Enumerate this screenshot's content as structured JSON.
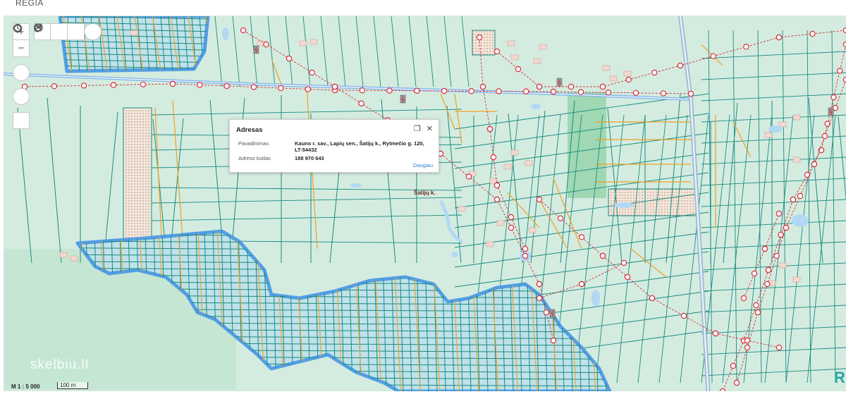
{
  "app": {
    "brand": "REGIA"
  },
  "toolbar": {
    "zoom_in": "+",
    "zoom_out": "−",
    "icons": [
      "print-icon",
      "mouse-icon",
      "share-icon",
      "locate-icon",
      "history-icon",
      "target-icon",
      "polygon-icon"
    ]
  },
  "popup": {
    "title": "Adresas",
    "rows": [
      {
        "label": "Pavadinimas",
        "value": "Kauno r. sav., Lapių sen., Šatijų k., Rytmečio g. 120, LT-54432"
      },
      {
        "label": "Adreso kodas",
        "value": "188 970 643"
      }
    ],
    "more_link": "Daugiau"
  },
  "map": {
    "place_label": "Šatijų k.",
    "scale_text": "M 1 : 5 000",
    "scale_bar_label": "100 m",
    "watermark": "skelbiu.lt",
    "logo_text": "R",
    "colors": {
      "background": "#d4ece0",
      "parcel_line": "#1a8a80",
      "road_line": "#f0a020",
      "settlement_outline": "#4d9be6",
      "power_line": "#d6303a"
    }
  }
}
